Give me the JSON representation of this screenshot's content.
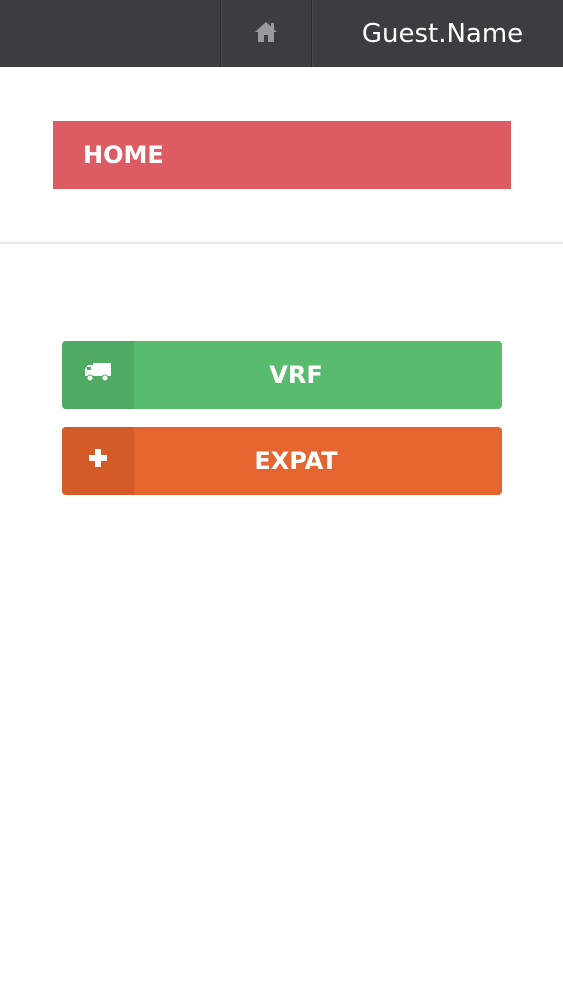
{
  "topbar": {
    "home_icon": "home-icon",
    "user_name": "Guest.Name"
  },
  "page": {
    "title": "HOME"
  },
  "menu": {
    "items": [
      {
        "label": "VRF",
        "icon": "truck-icon",
        "color": "#58bb6e"
      },
      {
        "label": "EXPAT",
        "icon": "plus-icon",
        "color": "#e5652e"
      }
    ]
  },
  "colors": {
    "topbar": "#3d3d3f",
    "header": "#dd5b62"
  }
}
